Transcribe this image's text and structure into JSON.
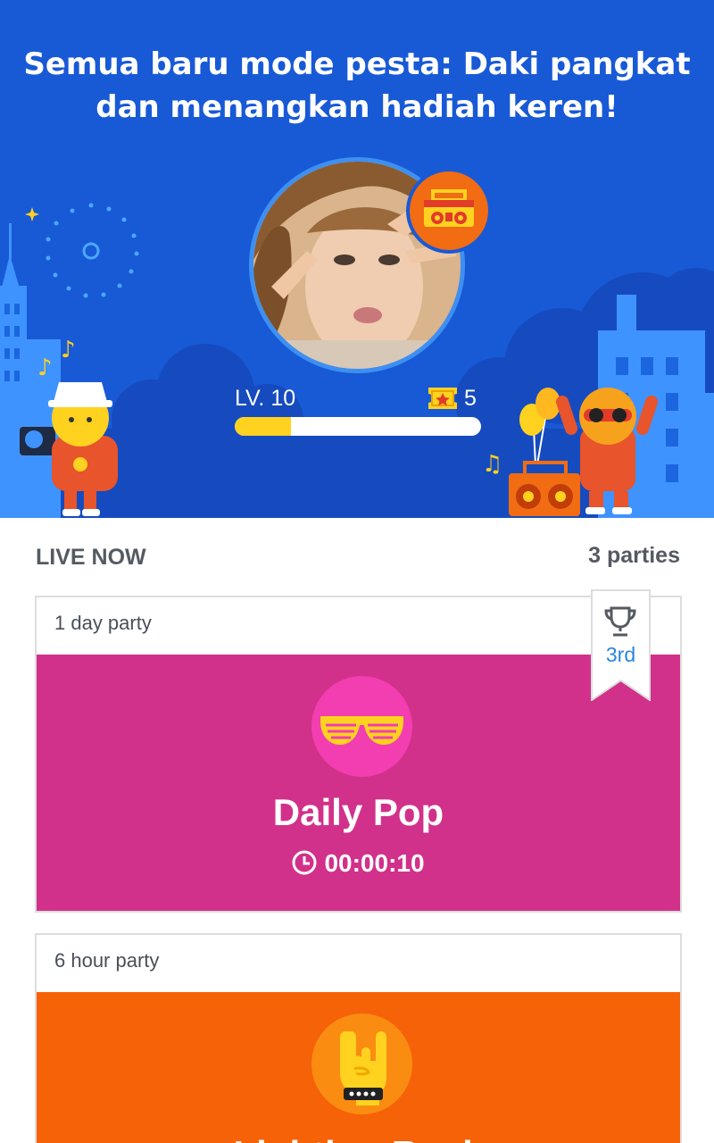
{
  "hero": {
    "title": "Semua baru mode pesta: Daki pangkat dan menangkan hadiah keren!",
    "level_label": "LV. 10",
    "ticket_count": "5",
    "level_progress": 0.23,
    "badge_icon": "boombox-icon",
    "colors": {
      "background": "#1859d6",
      "progress": "#ffd21f",
      "badge": "#f16c13"
    }
  },
  "live": {
    "title": "LIVE NOW",
    "count": "3 parties"
  },
  "parties": [
    {
      "duration": "1 day party",
      "name": "Daily Pop",
      "timer": "00:00:10",
      "icon": "shutter-shades-icon",
      "color": "#d1318a",
      "rank": "3rd"
    },
    {
      "duration": "6 hour party",
      "name": "Lighting Rock",
      "icon": "rock-hand-icon",
      "color": "#f66208"
    }
  ]
}
